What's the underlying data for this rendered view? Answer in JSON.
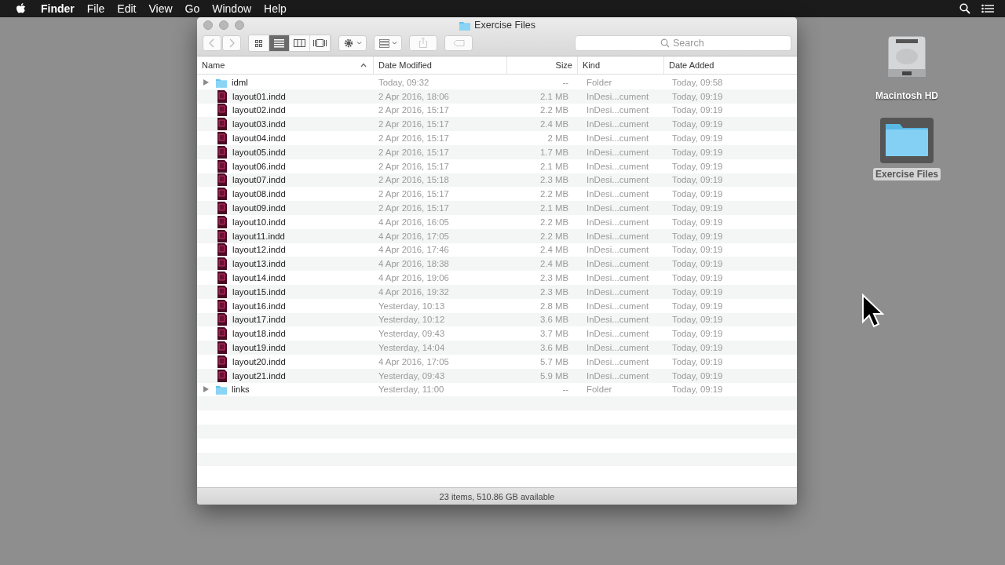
{
  "menu_bar": {
    "app": "Finder",
    "items": [
      "File",
      "Edit",
      "View",
      "Go",
      "Window",
      "Help"
    ]
  },
  "desktop": {
    "icons": [
      {
        "kind": "drive",
        "label": "Macintosh HD",
        "selected": false
      },
      {
        "kind": "folder",
        "label": "Exercise Files",
        "selected": true
      }
    ]
  },
  "window": {
    "title": "Exercise Files",
    "toolbar": {
      "views": [
        {
          "kind": "icons",
          "selected": false
        },
        {
          "kind": "list",
          "selected": true
        },
        {
          "kind": "columns",
          "selected": false
        },
        {
          "kind": "cover",
          "selected": false
        }
      ],
      "search": {
        "placeholder": "Search"
      }
    },
    "table": {
      "columns": [
        {
          "label": "Name",
          "sorted": true
        },
        {
          "label": "Date Modified",
          "sorted": false
        },
        {
          "label": "Size",
          "sorted": false
        },
        {
          "label": "Kind",
          "sorted": false
        },
        {
          "label": "Date Added",
          "sorted": false
        }
      ],
      "rows": [
        {
          "kind": "folder",
          "name": "idml",
          "modified": "Today, 09:32",
          "size": "--",
          "type": "Folder",
          "added": "Today, 09:58"
        },
        {
          "kind": "document",
          "name": "layout01.indd",
          "modified": "2 Apr 2016, 18:06",
          "size": "2.1 MB",
          "type": "InDesi...cument",
          "added": "Today, 09:19"
        },
        {
          "kind": "document",
          "name": "layout02.indd",
          "modified": "2 Apr 2016, 15:17",
          "size": "2.2 MB",
          "type": "InDesi...cument",
          "added": "Today, 09:19"
        },
        {
          "kind": "document",
          "name": "layout03.indd",
          "modified": "2 Apr 2016, 15:17",
          "size": "2.4 MB",
          "type": "InDesi...cument",
          "added": "Today, 09:19"
        },
        {
          "kind": "document",
          "name": "layout04.indd",
          "modified": "2 Apr 2016, 15:17",
          "size": "2 MB",
          "type": "InDesi...cument",
          "added": "Today, 09:19"
        },
        {
          "kind": "document",
          "name": "layout05.indd",
          "modified": "2 Apr 2016, 15:17",
          "size": "1.7 MB",
          "type": "InDesi...cument",
          "added": "Today, 09:19"
        },
        {
          "kind": "document",
          "name": "layout06.indd",
          "modified": "2 Apr 2016, 15:17",
          "size": "2.1 MB",
          "type": "InDesi...cument",
          "added": "Today, 09:19"
        },
        {
          "kind": "document",
          "name": "layout07.indd",
          "modified": "2 Apr 2016, 15:18",
          "size": "2.3 MB",
          "type": "InDesi...cument",
          "added": "Today, 09:19"
        },
        {
          "kind": "document",
          "name": "layout08.indd",
          "modified": "2 Apr 2016, 15:17",
          "size": "2.2 MB",
          "type": "InDesi...cument",
          "added": "Today, 09:19"
        },
        {
          "kind": "document",
          "name": "layout09.indd",
          "modified": "2 Apr 2016, 15:17",
          "size": "2.1 MB",
          "type": "InDesi...cument",
          "added": "Today, 09:19"
        },
        {
          "kind": "document",
          "name": "layout10.indd",
          "modified": "4 Apr 2016, 16:05",
          "size": "2.2 MB",
          "type": "InDesi...cument",
          "added": "Today, 09:19"
        },
        {
          "kind": "document",
          "name": "layout11.indd",
          "modified": "4 Apr 2016, 17:05",
          "size": "2.2 MB",
          "type": "InDesi...cument",
          "added": "Today, 09:19"
        },
        {
          "kind": "document",
          "name": "layout12.indd",
          "modified": "4 Apr 2016, 17:46",
          "size": "2.4 MB",
          "type": "InDesi...cument",
          "added": "Today, 09:19"
        },
        {
          "kind": "document",
          "name": "layout13.indd",
          "modified": "4 Apr 2016, 18:38",
          "size": "2.4 MB",
          "type": "InDesi...cument",
          "added": "Today, 09:19"
        },
        {
          "kind": "document",
          "name": "layout14.indd",
          "modified": "4 Apr 2016, 19:06",
          "size": "2.3 MB",
          "type": "InDesi...cument",
          "added": "Today, 09:19"
        },
        {
          "kind": "document",
          "name": "layout15.indd",
          "modified": "4 Apr 2016, 19:32",
          "size": "2.3 MB",
          "type": "InDesi...cument",
          "added": "Today, 09:19"
        },
        {
          "kind": "document",
          "name": "layout16.indd",
          "modified": "Yesterday, 10:13",
          "size": "2.8 MB",
          "type": "InDesi...cument",
          "added": "Today, 09:19"
        },
        {
          "kind": "document",
          "name": "layout17.indd",
          "modified": "Yesterday, 10:12",
          "size": "3.6 MB",
          "type": "InDesi...cument",
          "added": "Today, 09:19"
        },
        {
          "kind": "document",
          "name": "layout18.indd",
          "modified": "Yesterday, 09:43",
          "size": "3.7 MB",
          "type": "InDesi...cument",
          "added": "Today, 09:19"
        },
        {
          "kind": "document",
          "name": "layout19.indd",
          "modified": "Yesterday, 14:04",
          "size": "3.6 MB",
          "type": "InDesi...cument",
          "added": "Today, 09:19"
        },
        {
          "kind": "document",
          "name": "layout20.indd",
          "modified": "4 Apr 2016, 17:05",
          "size": "5.7 MB",
          "type": "InDesi...cument",
          "added": "Today, 09:19"
        },
        {
          "kind": "document",
          "name": "layout21.indd",
          "modified": "Yesterday, 09:43",
          "size": "5.9 MB",
          "type": "InDesi...cument",
          "added": "Today, 09:19"
        },
        {
          "kind": "folder",
          "name": "links",
          "modified": "Yesterday, 11:00",
          "size": "--",
          "type": "Folder",
          "added": "Today, 09:19"
        }
      ]
    },
    "status_bar": "23 items, 510.86 GB available"
  }
}
